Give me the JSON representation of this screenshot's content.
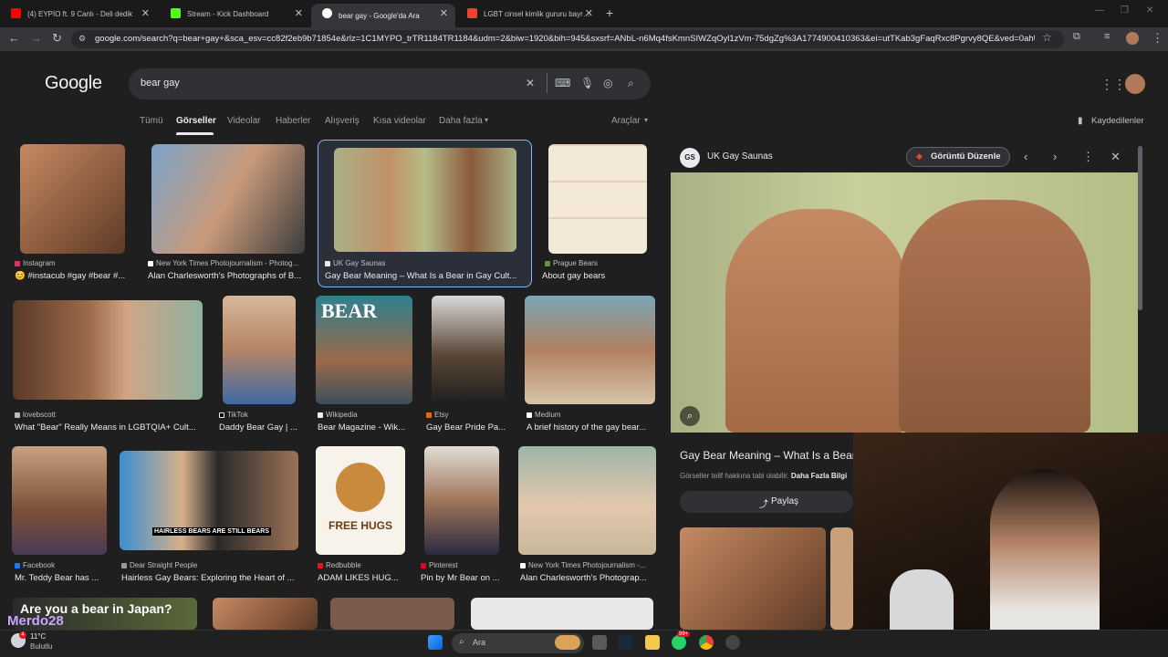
{
  "browser": {
    "tabs": [
      {
        "label": "(4) EYPİO ft. 9 Canlı - Deli dedik",
        "color": "#ff0000"
      },
      {
        "label": "Stream - Kick Dashboard",
        "color": "#53fc18"
      },
      {
        "label": "bear gay - Google'da Ara",
        "color": "#4285f4"
      },
      {
        "label": "LGBT cinsel kimlik gururu bayrağı",
        "color": "#ea4335"
      }
    ],
    "url": "google.com/search?q=bear+gay+&sca_esv=cc82f2eb9b71854e&rlz=1C1MYPO_trTR1184TR1184&udm=2&biw=1920&bih=945&sxsrf=ANbL-n6Mq4fsKmnSIWZqOyl1zVm-75dgZg%3A1774900410363&ei=utTKab3gFaqRxc8Pgrvy8QE&ved=0ahUKE..."
  },
  "google": {
    "logo": "Google",
    "query": "bear gay",
    "nav": [
      "Tümü",
      "Görseller",
      "Videolar",
      "Haberler",
      "Alışveriş",
      "Kısa videolar",
      "Daha fazla"
    ],
    "tools": "Araçlar",
    "saved": "Kaydedilenler"
  },
  "results": [
    {
      "source": "Instagram",
      "title": "😊 #instacub #gay #bear #..."
    },
    {
      "source": "New York Times Photojournalism - Photog...",
      "title": "Alan Charlesworth's Photographs of B..."
    },
    {
      "source": "UK Gay Saunas",
      "title": "Gay Bear Meaning – What Is a Bear in Gay Cult..."
    },
    {
      "source": "Prague Bears",
      "title": "About gay bears"
    },
    {
      "source": "lovebscott",
      "title": "What \"Bear\" Really Means in LGBTQIA+ Cult..."
    },
    {
      "source": "TikTok",
      "title": "Daddy Bear Gay | ..."
    },
    {
      "source": "Wikipedia",
      "title": "Bear Magazine - Wik..."
    },
    {
      "source": "Etsy",
      "title": "Gay Bear Pride Pa..."
    },
    {
      "source": "Medium",
      "title": "A brief history of the gay bear..."
    },
    {
      "source": "Facebook",
      "title": "Mr. Teddy Bear has ..."
    },
    {
      "source": "Dear Straight People",
      "title": "Hairless Gay Bears: Exploring the Heart of ..."
    },
    {
      "source": "Redbubble",
      "title": "ADAM LIKES HUG..."
    },
    {
      "source": "Pinterest",
      "title": "Pin by Mr Bear on ..."
    },
    {
      "source": "New York Times Photojournalism -...",
      "title": "Alan Charlesworth's Photograp..."
    }
  ],
  "thumb_text": {
    "bear_cover": "BEAR",
    "free_hugs": "FREE HUGS",
    "hairless": "HAIRLESS BEARS ARE STILL BEARS",
    "japan": "Are you a bear in Japan?"
  },
  "panel": {
    "source": "UK Gay Saunas",
    "logo_text": "GS",
    "edit_label": "Görüntü Düzenle",
    "title": "Gay Bear Meaning – What Is a Bear",
    "copyright": "Görseller telif hakkına tabi olabilir.",
    "more_info": "Daha Fazla Bilgi",
    "share_label": "Paylaş"
  },
  "overlay": {
    "streamer_name": "Merdo28"
  },
  "taskbar": {
    "temp": "11°C",
    "weather": "Bulutlu",
    "search": "Ara",
    "badge": "99+"
  }
}
